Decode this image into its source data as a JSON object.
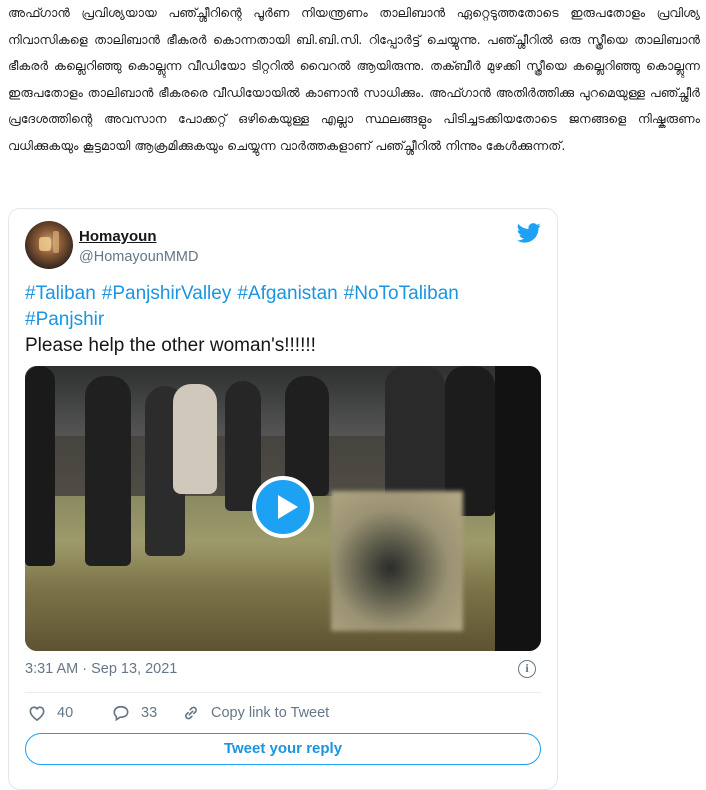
{
  "article": {
    "paragraph": "അഫ്ഗാൻ പ്രവിശ്യയായ പഞ്ച്ശീറിന്റെ പൂർണ നിയന്ത്രണം താലിബാൻ ഏറ്റെടുത്തതോടെ ഇരുപതോളം പ്രവിശ്യ നിവാസികളെ താലിബാൻ ഭീകരർ കൊന്നതായി ബി.ബി.സി. റിപ്പോർട്ട് ചെയ്യുന്നു. പഞ്ച്ശീറിൽ ഒരു സ്ത്രീയെ താലിബാൻ ഭീകരർ കല്ലെറിഞ്ഞു കൊല്ലുന്ന വീഡിയോ ടിറ്ററിൽ വൈറൽ ആയിരുന്നു. തക്ബീർ മുഴക്കി സ്ത്രീയെ കല്ലെറിഞ്ഞു കൊല്ലുന്ന ഇരുപതോളം താലിബാൻ ഭീകരരെ വീഡിയോയിൽ കാണാൻ സാധിക്കും. അഫ്ഗാൻ അതിർത്തിക്കു പുറമെയുള്ള പഞ്ച്ശീർ പ്രദേശത്തിന്റെ അവസാന പോക്കറ്റ് ഒഴികെയുള്ള എല്ലാ സ്ഥലങ്ങളും പിടിച്ചടക്കിയതോടെ ജനങ്ങളെ നിഷ്കരുണം വധിക്കുകയും കൂട്ടമായി ആക്രമിക്കുകയും ചെയ്യുന്ന വാർത്തകളാണ് പഞ്ച്ശീറിൽ നിന്നും കേൾക്കുന്നത്."
  },
  "tweet": {
    "display_name": "Homayoun",
    "handle": "@HomayounMMD",
    "hashtags": [
      "#Taliban",
      "#PanjshirValley",
      "#Afganistan",
      "#NoToTaliban",
      "#Panjshir"
    ],
    "body_text": "Please help the other woman's!!!!!!",
    "timestamp": "3:31 AM · Sep 13, 2021",
    "info_icon": "i",
    "likes": "40",
    "replies": "33",
    "copy_link_label": "Copy link to Tweet",
    "reply_button_label": "Tweet your reply",
    "icons": {
      "brand": "twitter-bird-icon",
      "like": "heart-icon",
      "reply": "comment-bubble-icon",
      "copy": "link-icon",
      "info": "info-icon",
      "play": "play-icon"
    },
    "colors": {
      "accent": "#1da1f2",
      "link": "#1b95e0",
      "muted": "#657786",
      "border": "#e1e8ed"
    }
  }
}
